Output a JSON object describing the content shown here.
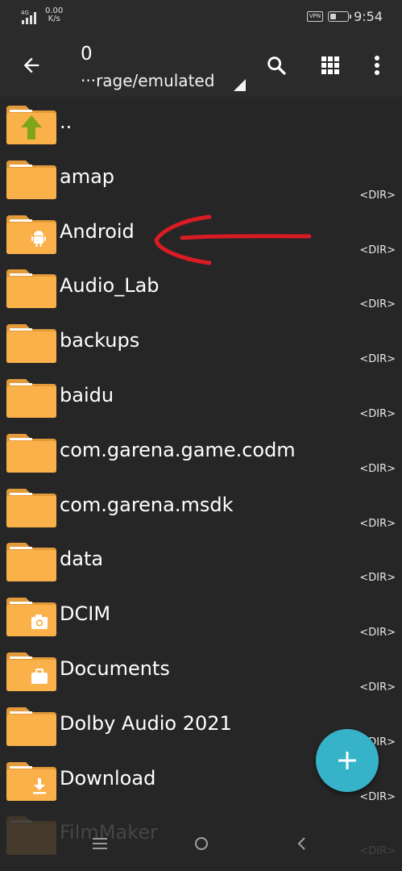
{
  "status_bar": {
    "network": "4G",
    "speed_value": "0.00",
    "speed_unit": "K/s",
    "vpn": "VPN",
    "battery_level": 0.35,
    "time": "9:54"
  },
  "toolbar": {
    "count": "0",
    "path": "···rage/emulated",
    "icons": [
      "back-arrow-icon",
      "search-icon",
      "grid-view-icon",
      "more-vert-icon"
    ]
  },
  "files": [
    {
      "name": "..",
      "tag": "",
      "badge": "up-arrow"
    },
    {
      "name": "amap",
      "tag": "<DIR>",
      "badge": ""
    },
    {
      "name": "Android",
      "tag": "<DIR>",
      "badge": "android"
    },
    {
      "name": "Audio_Lab",
      "tag": "<DIR>",
      "badge": ""
    },
    {
      "name": "backups",
      "tag": "<DIR>",
      "badge": ""
    },
    {
      "name": "baidu",
      "tag": "<DIR>",
      "badge": ""
    },
    {
      "name": "com.garena.game.codm",
      "tag": "<DIR>",
      "badge": ""
    },
    {
      "name": "com.garena.msdk",
      "tag": "<DIR>",
      "badge": ""
    },
    {
      "name": "data",
      "tag": "<DIR>",
      "badge": ""
    },
    {
      "name": "DCIM",
      "tag": "<DIR>",
      "badge": "camera"
    },
    {
      "name": "Documents",
      "tag": "<DIR>",
      "badge": "briefcase"
    },
    {
      "name": "Dolby Audio 2021",
      "tag": "<DIR>",
      "badge": ""
    },
    {
      "name": "Download",
      "tag": "<DIR>",
      "badge": "download"
    },
    {
      "name": "FilmMaker",
      "tag": "<DIR>",
      "badge": ""
    }
  ],
  "colors": {
    "background": "#262626",
    "toolbar": "#2b2b2b",
    "folder_body": "#fbb14a",
    "folder_tab": "#e29a3a",
    "fab": "#36b2c9",
    "annotation": "#d91c24"
  }
}
